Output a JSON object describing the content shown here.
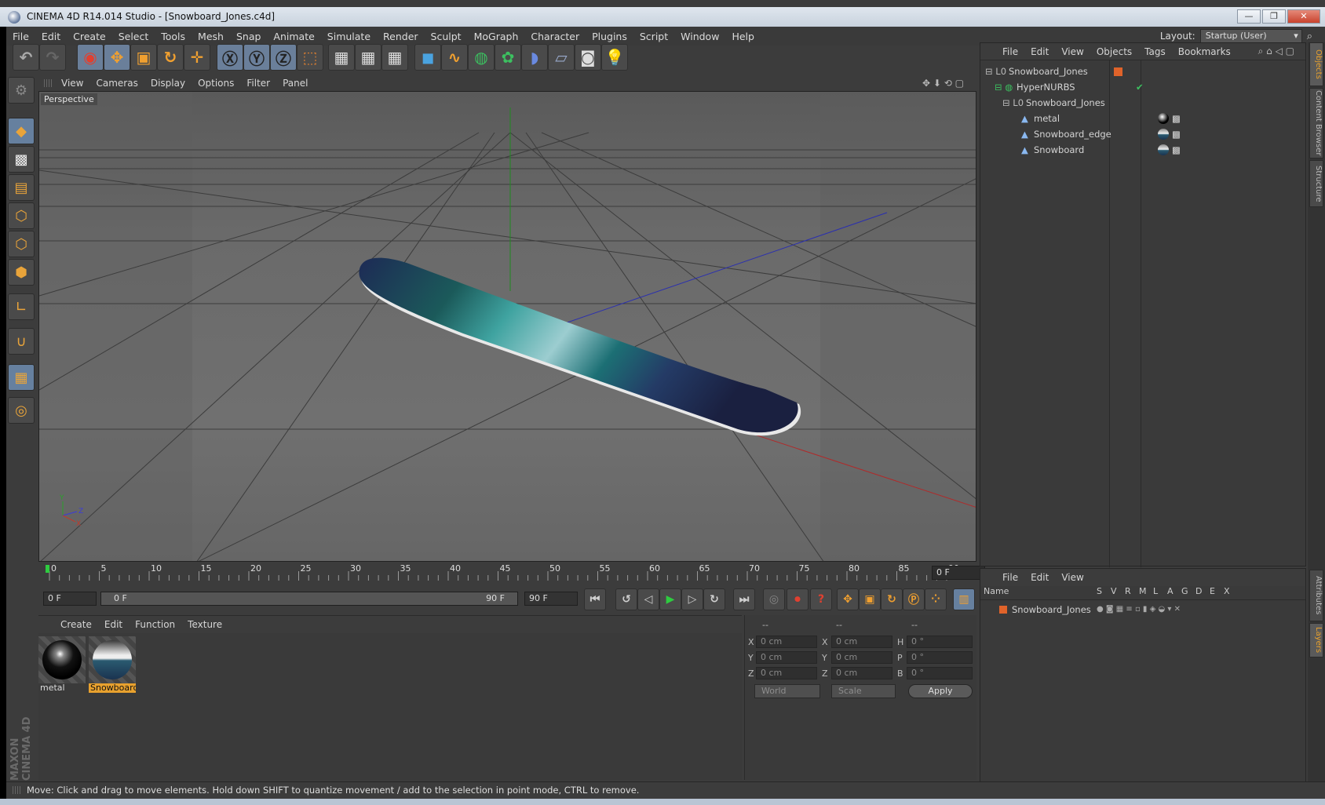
{
  "window": {
    "title": "CINEMA 4D R14.014 Studio - [Snowboard_Jones.c4d]",
    "buttons": [
      "—",
      "❐",
      "✕"
    ]
  },
  "menubar": {
    "items": [
      "File",
      "Edit",
      "Create",
      "Select",
      "Tools",
      "Mesh",
      "Snap",
      "Animate",
      "Simulate",
      "Render",
      "Sculpt",
      "MoGraph",
      "Character",
      "Plugins",
      "Script",
      "Window",
      "Help"
    ]
  },
  "layout": {
    "label": "Layout:",
    "value": "Startup (User)"
  },
  "viewport": {
    "menu": [
      "View",
      "Cameras",
      "Display",
      "Options",
      "Filter",
      "Panel"
    ],
    "label": "Perspective",
    "axis": {
      "y": "Y",
      "z": "Z",
      "x": "X"
    }
  },
  "timeline": {
    "ticks": [
      "0",
      "5",
      "10",
      "15",
      "20",
      "25",
      "30",
      "35",
      "40",
      "45",
      "50",
      "55",
      "60",
      "65",
      "70",
      "75",
      "80",
      "85",
      "90"
    ],
    "current_frame": "0 F",
    "start": "0 F",
    "range_start": "0 F",
    "range_end": "90 F",
    "end": "90 F"
  },
  "materials": {
    "menu": [
      "Create",
      "Edit",
      "Function",
      "Texture"
    ],
    "items": [
      {
        "name": "metal"
      },
      {
        "name": "Snowboard"
      }
    ]
  },
  "coords": {
    "headers": [
      "--",
      "--",
      "--"
    ],
    "rows": [
      {
        "a": "X",
        "av": "0 cm",
        "b": "X",
        "bv": "0 cm",
        "c": "H",
        "cv": "0 °"
      },
      {
        "a": "Y",
        "av": "0 cm",
        "b": "Y",
        "bv": "0 cm",
        "c": "P",
        "cv": "0 °"
      },
      {
        "a": "Z",
        "av": "0 cm",
        "b": "Z",
        "bv": "0 cm",
        "c": "B",
        "cv": "0 °"
      }
    ],
    "mode1": "World",
    "mode2": "Scale",
    "apply": "Apply"
  },
  "objects": {
    "menu": [
      "File",
      "Edit",
      "View",
      "Objects",
      "Tags",
      "Bookmarks"
    ],
    "tree": [
      {
        "name": "Snowboard_Jones"
      },
      {
        "name": "HyperNURBS"
      },
      {
        "name": "Snowboard_Jones"
      },
      {
        "name": "metal"
      },
      {
        "name": "Snowboard_edge"
      },
      {
        "name": "Snowboard"
      }
    ]
  },
  "layers": {
    "menu": [
      "File",
      "Edit",
      "View"
    ],
    "columns": [
      "Name",
      "S",
      "V",
      "R",
      "M",
      "L",
      "A",
      "G",
      "D",
      "E",
      "X"
    ],
    "rows": [
      {
        "name": "Snowboard_Jones"
      }
    ]
  },
  "right_tabs": [
    "Objects",
    "Content Browser",
    "Structure",
    "Attributes",
    "Layers"
  ],
  "brand": "MAXON CINEMA 4D",
  "status": "Move: Click and drag to move elements. Hold down SHIFT to quantize movement / add to the selection in point mode, CTRL to remove.",
  "colors": {
    "accent": "#e8a12e",
    "selection": "#66809f",
    "x_axis": "#c0392b",
    "y_axis": "#2aa02a",
    "z_axis": "#2a3fc0"
  }
}
